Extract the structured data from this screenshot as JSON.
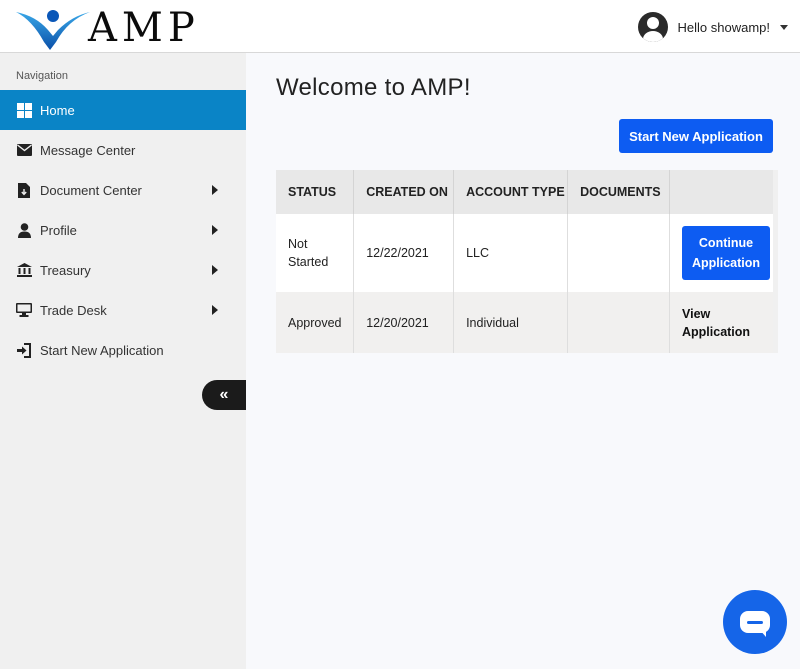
{
  "brand": {
    "logo_text": "AMP",
    "accent": "#0a84c6",
    "primary_button_color": "#0d5cf2"
  },
  "header": {
    "greeting": "Hello showamp!",
    "avatar_icon": "user-circle-icon"
  },
  "sidebar": {
    "label": "Navigation",
    "items": [
      {
        "label": "Home",
        "icon": "grid-icon",
        "active": true,
        "has_submenu": false
      },
      {
        "label": "Message Center",
        "icon": "envelope-icon",
        "active": false,
        "has_submenu": false
      },
      {
        "label": "Document Center",
        "icon": "file-download-icon",
        "active": false,
        "has_submenu": true
      },
      {
        "label": "Profile",
        "icon": "user-icon",
        "active": false,
        "has_submenu": true
      },
      {
        "label": "Treasury",
        "icon": "bank-icon",
        "active": false,
        "has_submenu": true
      },
      {
        "label": "Trade Desk",
        "icon": "monitor-icon",
        "active": false,
        "has_submenu": true
      },
      {
        "label": "Start New Application",
        "icon": "sign-in-icon",
        "active": false,
        "has_submenu": false
      }
    ],
    "collapse_glyph": "«"
  },
  "main": {
    "title": "Welcome to AMP!",
    "start_button": "Start New Application",
    "table": {
      "headers": [
        "STATUS",
        "CREATED ON",
        "ACCOUNT TYPE",
        "DOCUMENTS",
        ""
      ],
      "rows": [
        {
          "status": "Not Started",
          "created_on": "12/22/2021",
          "account_type": "LLC",
          "documents": "",
          "action": "Continue Application"
        },
        {
          "status": "Approved",
          "created_on": "12/20/2021",
          "account_type": "Individual",
          "documents": "",
          "action": "View Application"
        }
      ]
    }
  },
  "chat": {
    "icon": "chat-bubble-icon"
  }
}
